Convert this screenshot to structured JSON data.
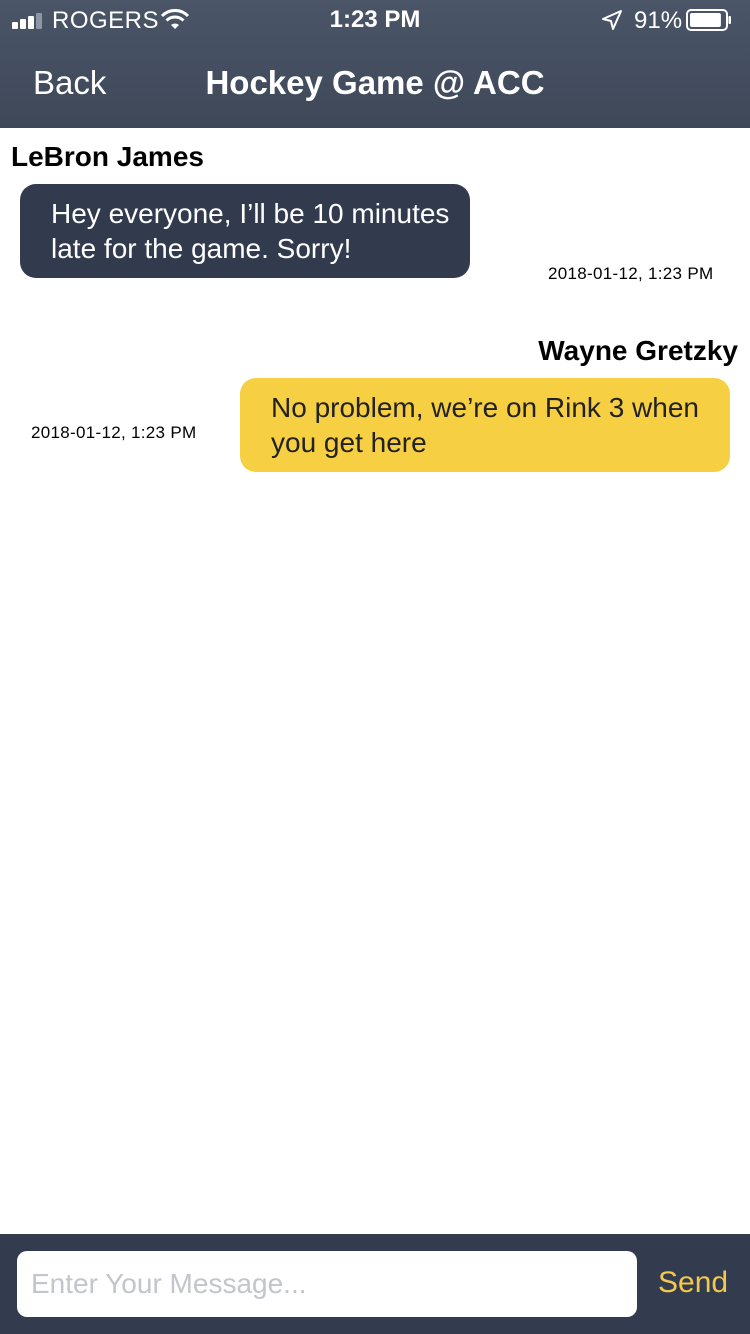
{
  "status_bar": {
    "carrier": "ROGERS",
    "time": "1:23 PM",
    "battery_percent": "91%",
    "battery_level": 0.91,
    "signal_bars": 3,
    "signal_max": 5,
    "icons": [
      "signal-bars-icon",
      "wifi-icon",
      "location-arrow-icon",
      "battery-icon"
    ]
  },
  "nav": {
    "back_label": "Back",
    "title": "Hockey Game @ ACC"
  },
  "messages": [
    {
      "sender": "LeBron James",
      "text": "Hey everyone, I’ll be 10 minutes late for the game. Sorry!",
      "timestamp": "2018-01-12, 1:23 PM",
      "direction": "incoming"
    },
    {
      "sender": "Wayne Gretzky",
      "text": "No problem, we’re on Rink 3 when you get here",
      "timestamp": "2018-01-12, 1:23 PM",
      "direction": "outgoing"
    }
  ],
  "composer": {
    "placeholder": "Enter Your Message...",
    "value": "",
    "send_label": "Send"
  },
  "colors": {
    "header_bg": "#45505f",
    "incoming_bubble": "#323b4d",
    "outgoing_bubble": "#f6cf43",
    "composer_bg": "#333c4e",
    "send_accent": "#f2c94c"
  }
}
